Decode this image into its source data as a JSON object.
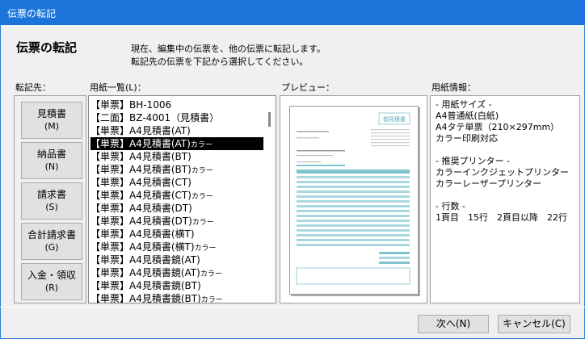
{
  "window": {
    "title": "伝票の転記"
  },
  "header": {
    "heading": "伝票の転記",
    "desc_line1": "現在、編集中の伝票を、他の伝票に転記します。",
    "desc_line2": "転記先の伝票を下記から選択してください。"
  },
  "labels": {
    "destination": "転記先：",
    "paper_list": "用紙一覧(L)：",
    "preview": "プレビュー：",
    "paper_info": "用紙情報："
  },
  "destinations": [
    {
      "label": "見積書",
      "accel": "(M)"
    },
    {
      "label": "納品書",
      "accel": "(N)"
    },
    {
      "label": "請求書",
      "accel": "(S)"
    },
    {
      "label": "合計請求書",
      "accel": "(G)"
    },
    {
      "label": "入金・領収",
      "accel": "(R)"
    }
  ],
  "paper_list": {
    "items": [
      {
        "text": "【単票】BH-1006",
        "color": ""
      },
      {
        "text": "【二面】BZ-4001（見積書）",
        "color": ""
      },
      {
        "text": "【単票】A4見積書(AT)",
        "color": ""
      },
      {
        "text": "【単票】A4見積書(AT)",
        "color": "カラー"
      },
      {
        "text": "【単票】A4見積書(BT)",
        "color": ""
      },
      {
        "text": "【単票】A4見積書(BT)",
        "color": "カラー"
      },
      {
        "text": "【単票】A4見積書(CT)",
        "color": ""
      },
      {
        "text": "【単票】A4見積書(CT)",
        "color": "カラー"
      },
      {
        "text": "【単票】A4見積書(DT)",
        "color": ""
      },
      {
        "text": "【単票】A4見積書(DT)",
        "color": "カラー"
      },
      {
        "text": "【単票】A4見積書(横T)",
        "color": ""
      },
      {
        "text": "【単票】A4見積書(横T)",
        "color": "カラー"
      },
      {
        "text": "【単票】A4見積書鏡(AT)",
        "color": ""
      },
      {
        "text": "【単票】A4見積書鏡(AT)",
        "color": "カラー"
      },
      {
        "text": "【単票】A4見積書鏡(BT)",
        "color": ""
      },
      {
        "text": "【単票】A4見積書鏡(BT)",
        "color": "カラー"
      }
    ],
    "selected_index": 3
  },
  "preview": {
    "doc_title": "御見積書",
    "accent_color": "#7fc4cf"
  },
  "paper_info": {
    "lines": [
      "- 用紙サイズ -",
      "A4普通紙(白紙)",
      "A4タテ単票（210×297mm）",
      "カラー印刷対応",
      "",
      "- 推奨プリンター -",
      "カラーインクジェットプリンター",
      "カラーレーザープリンター",
      "",
      "- 行数 -",
      "1頁目　15行　2頁目以降　22行"
    ]
  },
  "buttons": {
    "next": "次へ(N)",
    "cancel": "キャンセル(C)"
  }
}
